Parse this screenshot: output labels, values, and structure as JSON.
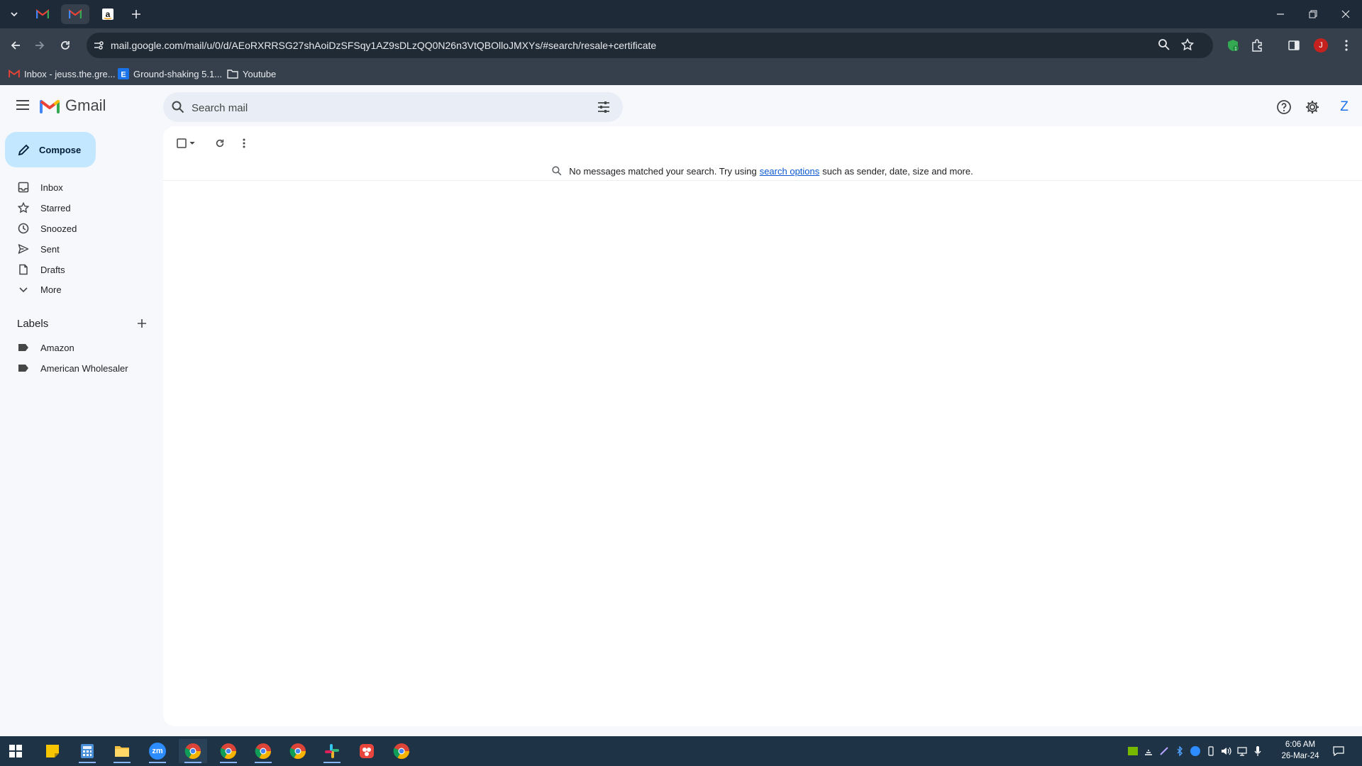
{
  "browser": {
    "tabs": [
      {
        "icon": "gmail-icon"
      },
      {
        "icon": "gmail-icon",
        "active": true
      },
      {
        "icon": "amazon-icon"
      }
    ],
    "url": "mail.google.com/mail/u/0/d/AEoRXRRSG27shAoiDzSFSqy1AZ9sDLzQQ0N26n3VtQBOlloJMXYs/#search/resale+certificate",
    "profile_initial": "J",
    "bookmarks": [
      {
        "label": "Inbox - jeuss.the.gre...",
        "icon": "gmail-icon"
      },
      {
        "label": "Ground-shaking 5.1...",
        "icon": "e-badge-icon"
      },
      {
        "label": "Youtube",
        "icon": "folder-icon"
      }
    ]
  },
  "gmail": {
    "logo_text": "Gmail",
    "search": {
      "placeholder": "Search mail"
    },
    "compose_label": "Compose",
    "nav": [
      {
        "label": "Inbox",
        "icon": "inbox-icon"
      },
      {
        "label": "Starred",
        "icon": "star-icon"
      },
      {
        "label": "Snoozed",
        "icon": "clock-icon"
      },
      {
        "label": "Sent",
        "icon": "send-icon"
      },
      {
        "label": "Drafts",
        "icon": "draft-icon"
      },
      {
        "label": "More",
        "icon": "chevron-down-icon"
      }
    ],
    "labels_heading": "Labels",
    "labels": [
      {
        "label": "Amazon"
      },
      {
        "label": "American Wholesaler"
      }
    ],
    "account_initial": "Z",
    "empty_state": {
      "prefix": "No messages matched your search. Try using",
      "link": "search options",
      "suffix": "such as sender, date, size and more."
    }
  },
  "taskbar": {
    "time": "6:06 AM",
    "date": "26-Mar-24",
    "zoom_label": "zm"
  },
  "colors": {
    "accent_blue": "#0b57d0",
    "compose_bg": "#c2e7ff",
    "gmail_bg": "#f6f8fc"
  }
}
